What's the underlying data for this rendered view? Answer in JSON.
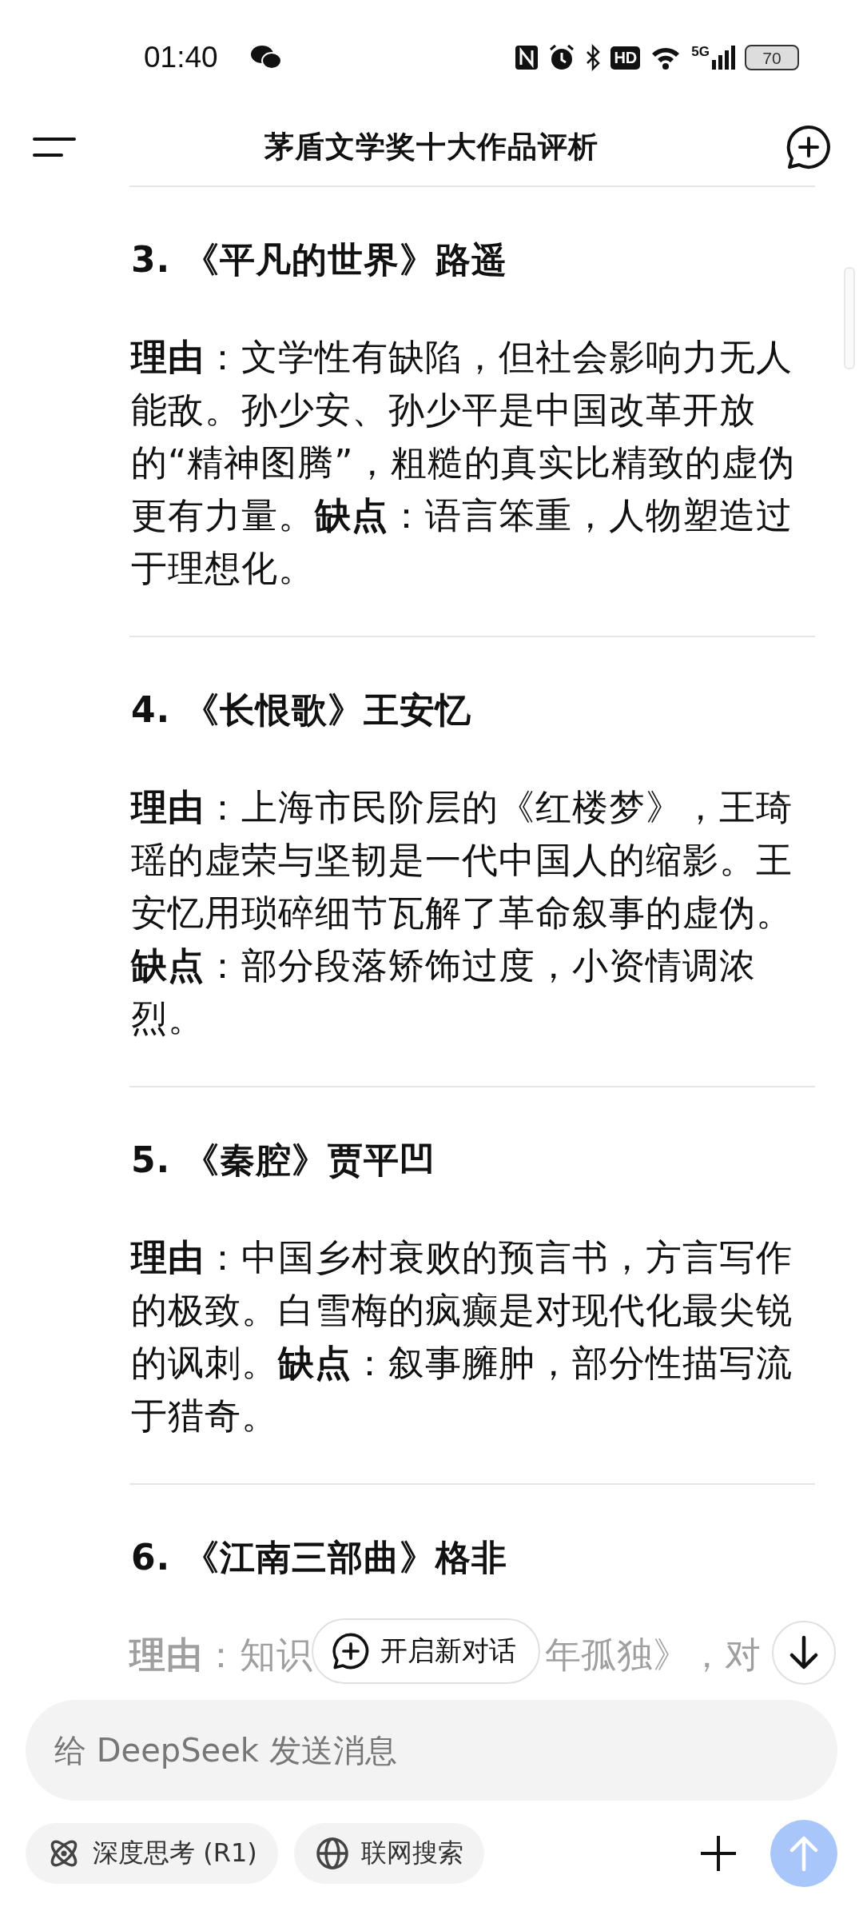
{
  "status_bar": {
    "time": "01:40",
    "hd": "HD",
    "network": "5G",
    "battery": "70"
  },
  "header": {
    "title": "茅盾文学奖十大作品评析"
  },
  "sections": [
    {
      "heading": "3. 《平凡的世界》路遥",
      "body": "**理由**：文学性有缺陷，但社会影响力无人能敌。孙少安、孙少平是中国改革开放的“精神图腾”，粗糙的真实比精致的虚伪更有力量。**缺点**：语言笨重，人物塑造过于理想化。"
    },
    {
      "heading": "4. 《长恨歌》王安忆",
      "body": "**理由**：上海市民阶层的《红楼梦》，王琦瑶的虚荣与坚韧是一代中国人的缩影。王安忆用琐碎细节瓦解了革命叙事的虚伪。**缺点**：部分段落矫饰过度，小资情调浓烈。"
    },
    {
      "heading": "5. 《秦腔》贾平凹",
      "body": "**理由**：中国乡村衰败的预言书，方言写作的极致。白雪梅的疯癫是对现代化最尖锐的讽刺。**缺点**：叙事臃肿，部分性描写流于猎奇。"
    }
  ],
  "partial_section": {
    "heading": "6. 《江南三部曲》格非",
    "fragments": [
      "**理由**：知识",
      "年孤独》，对"
    ]
  },
  "new_chat_button": {
    "label": "开启新对话"
  },
  "composer": {
    "placeholder": "给 DeepSeek 发送消息",
    "toggles": [
      {
        "kind": "think",
        "label": "深度思考 (R1)",
        "selected": false
      },
      {
        "kind": "web",
        "label": "联网搜索",
        "selected": false
      }
    ],
    "send_button": {
      "disabled": true
    }
  }
}
